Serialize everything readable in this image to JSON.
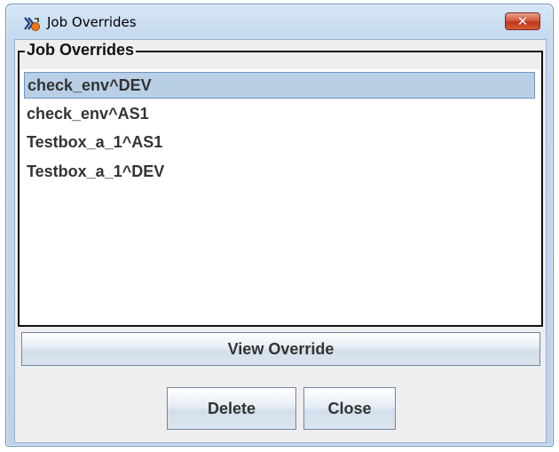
{
  "window": {
    "title": "Job Overrides",
    "close_glyph": "✕"
  },
  "group": {
    "legend": "Job Overrides"
  },
  "list": {
    "items": [
      {
        "label": "check_env^DEV",
        "selected": true
      },
      {
        "label": "check_env^AS1",
        "selected": false
      },
      {
        "label": "Testbox_a_1^AS1",
        "selected": false
      },
      {
        "label": "Testbox_a_1^DEV",
        "selected": false
      }
    ]
  },
  "buttons": {
    "view_override": "View Override",
    "delete": "Delete",
    "close": "Close"
  },
  "icons": {
    "app": "java-app-icon",
    "close": "close-icon"
  },
  "colors": {
    "selection": "#b8cfe5",
    "close_button": "#c8452a"
  }
}
